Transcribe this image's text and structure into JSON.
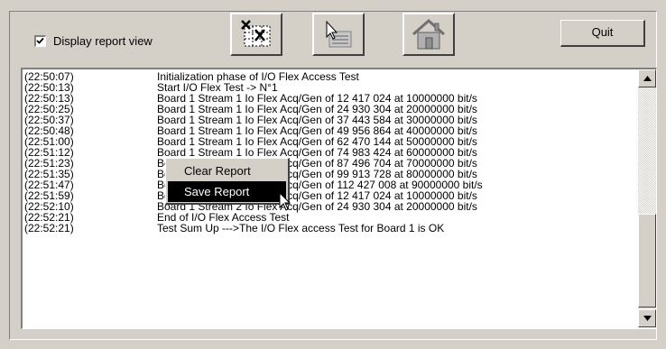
{
  "options": {
    "display_report_label": "Display report view",
    "display_report_checked": true
  },
  "toolbar": {
    "quit_label": "Quit"
  },
  "report": {
    "lines": [
      {
        "time": "(22:50:07)",
        "msg": "Initialization phase of I/O Flex Access Test"
      },
      {
        "time": "(22:50:13)",
        "msg": "Start I/O Flex Test -> N°1"
      },
      {
        "time": "(22:50:13)",
        "msg": "Board 1 Stream 1 Io Flex Acq/Gen of 12 417 024  at 10000000 bit/s"
      },
      {
        "time": "(22:50:25)",
        "msg": "Board 1 Stream 1 Io Flex Acq/Gen of 24 930 304  at 20000000 bit/s"
      },
      {
        "time": "(22:50:37)",
        "msg": "Board 1 Stream 1 Io Flex Acq/Gen of 37 443 584  at 30000000 bit/s"
      },
      {
        "time": "(22:50:48)",
        "msg": "Board 1 Stream 1 Io Flex Acq/Gen of 49 956 864  at 40000000 bit/s"
      },
      {
        "time": "(22:51:00)",
        "msg": "Board 1 Stream 1 Io Flex Acq/Gen of 62 470 144  at 50000000 bit/s"
      },
      {
        "time": "(22:51:12)",
        "msg": "Board 1 Stream 1 Io Flex Acq/Gen of 74 983 424  at 60000000 bit/s"
      },
      {
        "time": "(22:51:23)",
        "msg": "Board 1 Stream 1 Io Flex Acq/Gen of 87 496 704  at 70000000 bit/s"
      },
      {
        "time": "(22:51:35)",
        "msg": "Board 1 Stream 1 Io Flex Acq/Gen of 99 913 728  at 80000000 bit/s"
      },
      {
        "time": "(22:51:47)",
        "msg": "Board 1 Stream 1 Io Flex Acq/Gen of 112 427 008  at 90000000 bit/s"
      },
      {
        "time": "(22:51:59)",
        "msg": "Board 1 Stream 2 Io Flex Acq/Gen of 12 417 024  at 10000000 bit/s"
      },
      {
        "time": "(22:52:10)",
        "msg": "Board 1 Stream 2 Io Flex Acq/Gen of 24 930 304  at 20000000 bit/s"
      },
      {
        "time": "(22:52:21)",
        "msg": "End of I/O Flex Access Test"
      },
      {
        "time": "(22:52:21)",
        "msg": "Test Sum Up --->The I/O Flex access Test for Board 1 is OK"
      }
    ]
  },
  "context_menu": {
    "clear_label": "Clear Report",
    "save_label": "Save Report"
  },
  "icons": {
    "toolbar_button_1": "clear-grid-icon",
    "toolbar_button_2": "cursor-chart-icon",
    "toolbar_button_3": "home-icon"
  }
}
